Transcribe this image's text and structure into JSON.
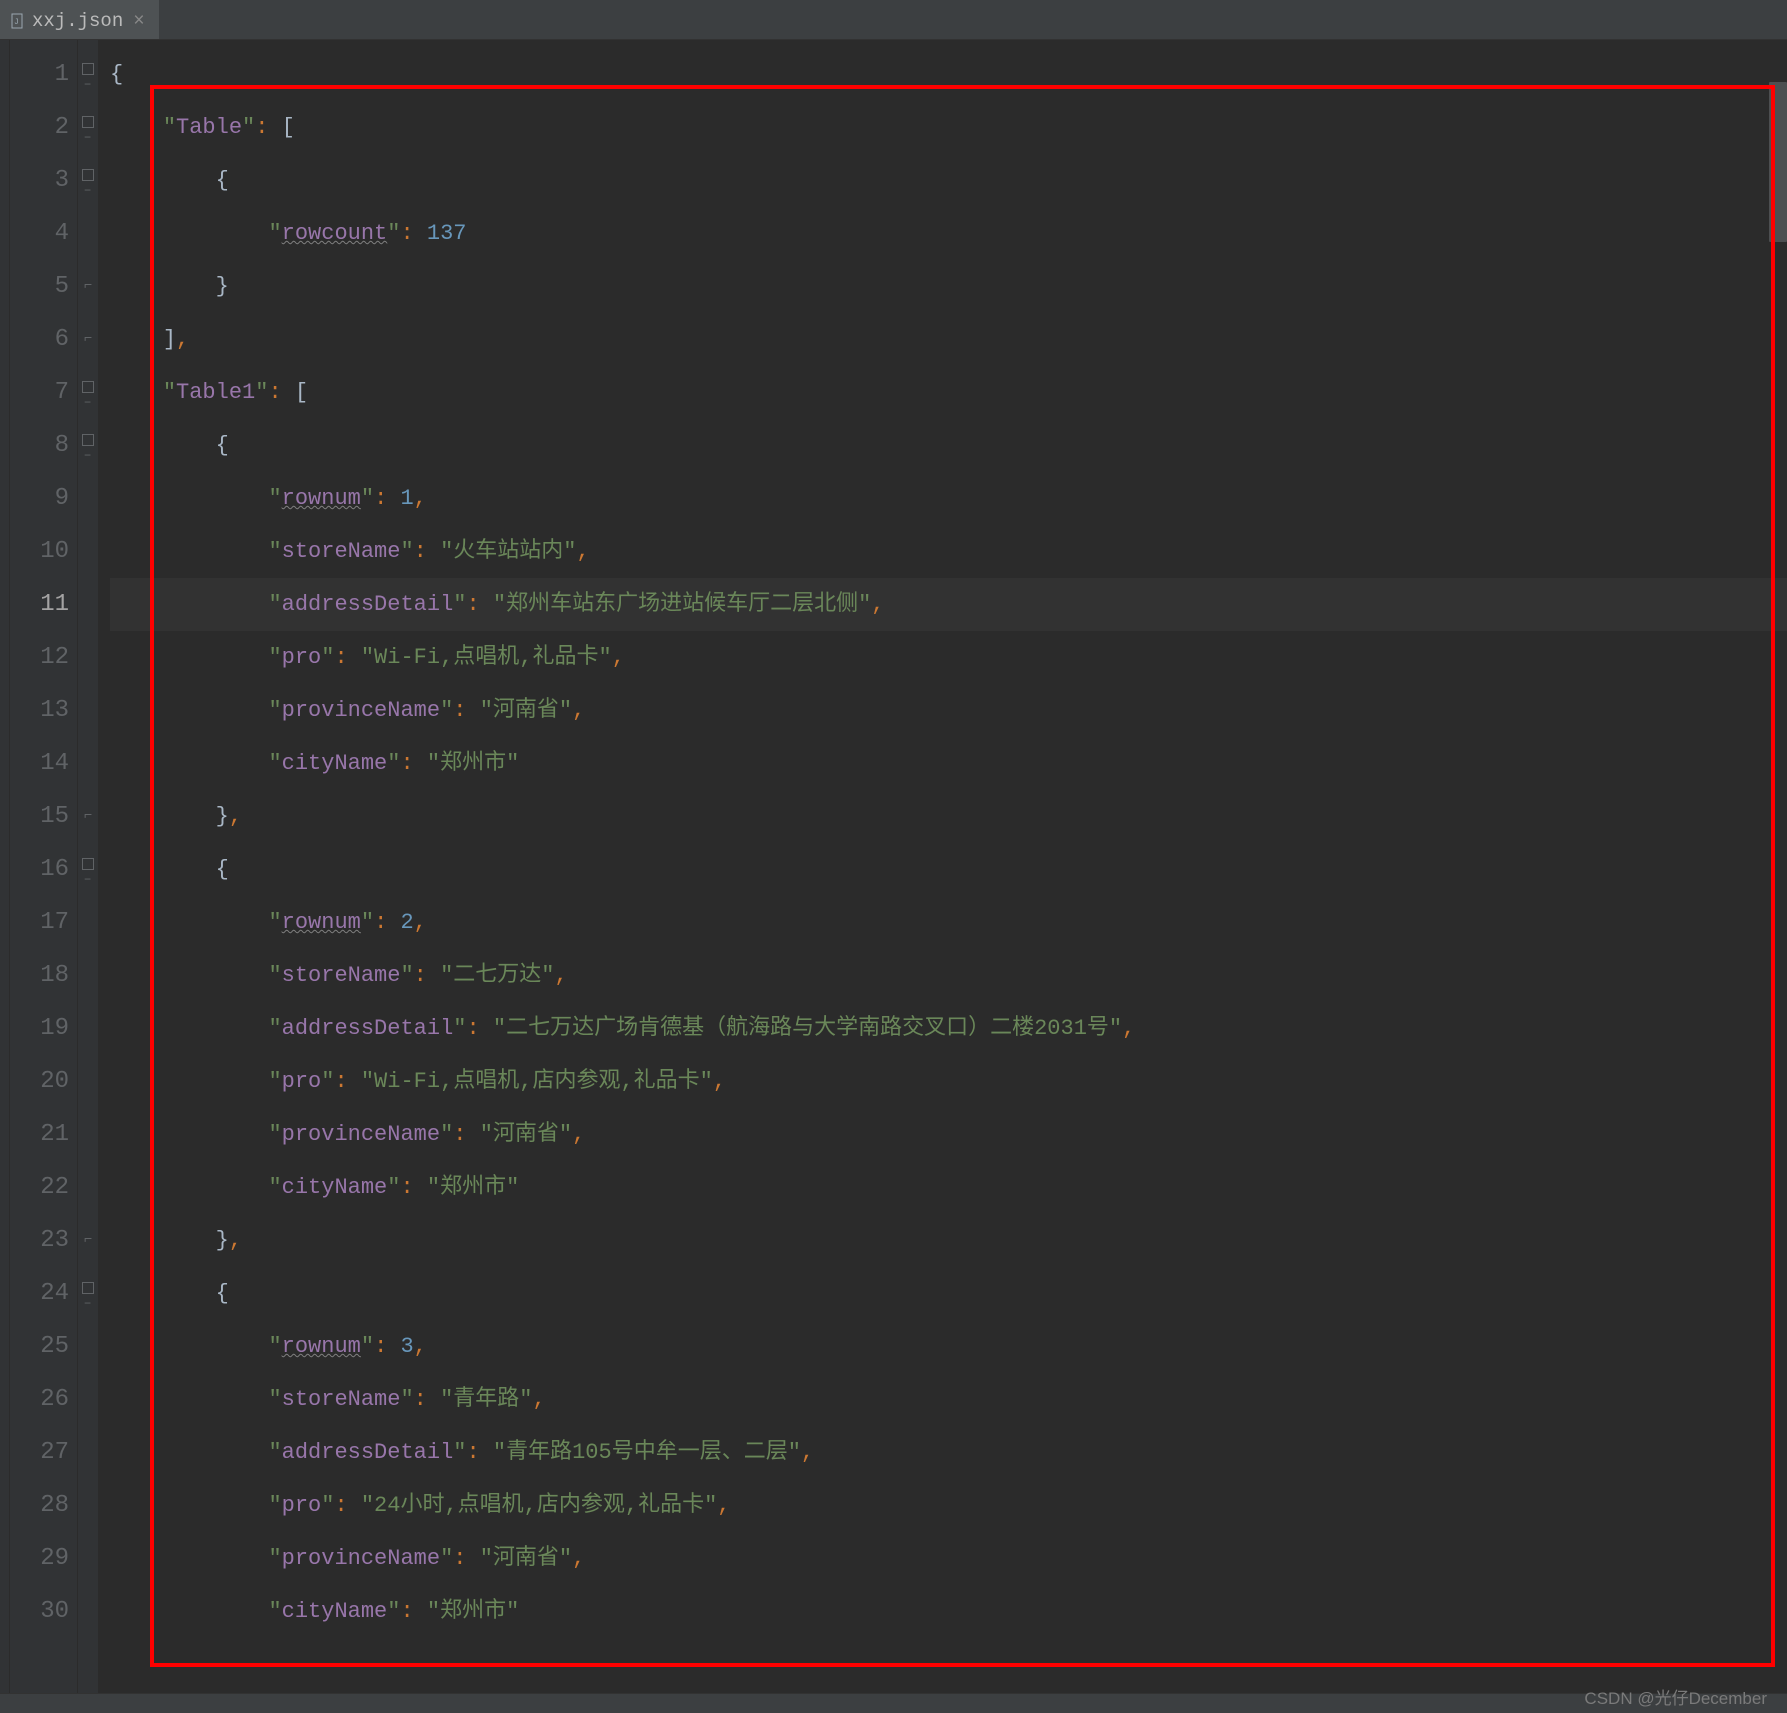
{
  "tab": {
    "filename": "xxj.json"
  },
  "lineNumbers": [
    "1",
    "2",
    "3",
    "4",
    "5",
    "6",
    "7",
    "8",
    "9",
    "10",
    "11",
    "12",
    "13",
    "14",
    "15",
    "16",
    "17",
    "18",
    "19",
    "20",
    "21",
    "22",
    "23",
    "24",
    "25",
    "26",
    "27",
    "28",
    "29",
    "30"
  ],
  "currentLine": 11,
  "code": {
    "line1": {
      "brace": "{"
    },
    "line2": {
      "indent": "    ",
      "key": "Table",
      "bracket": "["
    },
    "line3": {
      "indent": "        ",
      "brace": "{"
    },
    "line4": {
      "indent": "            ",
      "key": "rowcount",
      "value": "137",
      "type": "number"
    },
    "line5": {
      "indent": "        ",
      "brace": "}"
    },
    "line6": {
      "indent": "    ",
      "bracket": "]",
      "comma": ","
    },
    "line7": {
      "indent": "    ",
      "key": "Table1",
      "bracket": "["
    },
    "line8": {
      "indent": "        ",
      "brace": "{"
    },
    "line9": {
      "indent": "            ",
      "key": "rownum",
      "value": "1",
      "type": "number",
      "comma": ","
    },
    "line10": {
      "indent": "            ",
      "key": "storeName",
      "value": "火车站站内",
      "type": "string",
      "comma": ","
    },
    "line11": {
      "indent": "            ",
      "key": "addressDetail",
      "value": "郑州车站东广场进站候车厅二层北侧",
      "type": "string",
      "comma": ","
    },
    "line12": {
      "indent": "            ",
      "key": "pro",
      "value": "Wi-Fi,点唱机,礼品卡",
      "type": "string",
      "comma": ","
    },
    "line13": {
      "indent": "            ",
      "key": "provinceName",
      "value": "河南省",
      "type": "string",
      "comma": ","
    },
    "line14": {
      "indent": "            ",
      "key": "cityName",
      "value": "郑州市",
      "type": "string"
    },
    "line15": {
      "indent": "        ",
      "brace": "}",
      "comma": ","
    },
    "line16": {
      "indent": "        ",
      "brace": "{"
    },
    "line17": {
      "indent": "            ",
      "key": "rownum",
      "value": "2",
      "type": "number",
      "comma": ","
    },
    "line18": {
      "indent": "            ",
      "key": "storeName",
      "value": "二七万达",
      "type": "string",
      "comma": ","
    },
    "line19": {
      "indent": "            ",
      "key": "addressDetail",
      "value": "二七万达广场肯德基（航海路与大学南路交叉口）二楼2031号",
      "type": "string",
      "comma": ","
    },
    "line20": {
      "indent": "            ",
      "key": "pro",
      "value": "Wi-Fi,点唱机,店内参观,礼品卡",
      "type": "string",
      "comma": ","
    },
    "line21": {
      "indent": "            ",
      "key": "provinceName",
      "value": "河南省",
      "type": "string",
      "comma": ","
    },
    "line22": {
      "indent": "            ",
      "key": "cityName",
      "value": "郑州市",
      "type": "string"
    },
    "line23": {
      "indent": "        ",
      "brace": "}",
      "comma": ","
    },
    "line24": {
      "indent": "        ",
      "brace": "{"
    },
    "line25": {
      "indent": "            ",
      "key": "rownum",
      "value": "3",
      "type": "number",
      "comma": ","
    },
    "line26": {
      "indent": "            ",
      "key": "storeName",
      "value": "青年路",
      "type": "string",
      "comma": ","
    },
    "line27": {
      "indent": "            ",
      "key": "addressDetail",
      "value": "青年路105号中牟一层、二层",
      "type": "string",
      "comma": ","
    },
    "line28": {
      "indent": "            ",
      "key": "pro",
      "value": "24小时,点唱机,店内参观,礼品卡",
      "type": "string",
      "comma": ","
    },
    "line29": {
      "indent": "            ",
      "key": "provinceName",
      "value": "河南省",
      "type": "string",
      "comma": ","
    },
    "line30": {
      "indent": "            ",
      "key": "cityName",
      "value": "郑州市",
      "type": "string"
    }
  },
  "underlinedKeys": [
    "rowcount",
    "rownum"
  ],
  "watermark": "CSDN @光仔December"
}
